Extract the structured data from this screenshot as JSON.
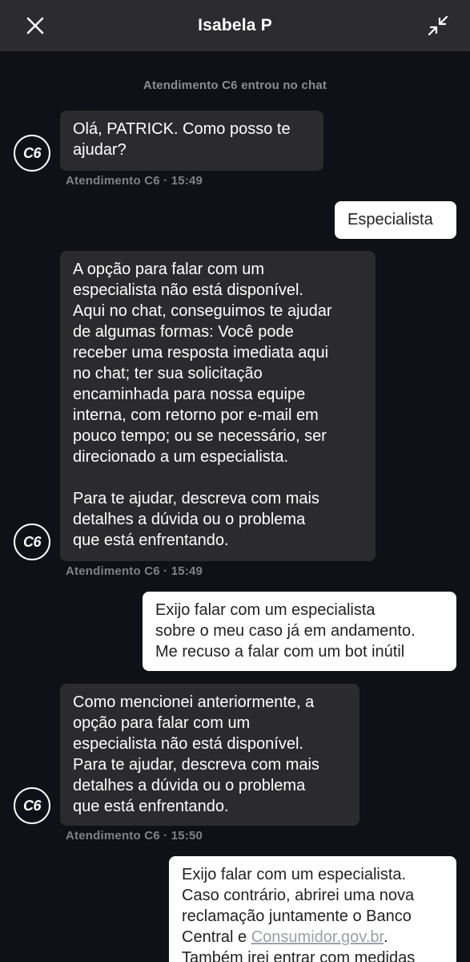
{
  "header": {
    "title": "Isabela P",
    "close_icon": "close-icon",
    "minimize_icon": "minimize-icon"
  },
  "chat": {
    "system_message": "Atendimento C6 entrou no chat",
    "avatar_label": "C6",
    "messages": [
      {
        "sender": "agent",
        "text": "Olá, PATRICK. Como posso te\najudar?",
        "meta": "Atendimento C6 · 15:49"
      },
      {
        "sender": "user",
        "text": "Especialista"
      },
      {
        "sender": "agent",
        "text": "A opção para falar com um\nespecialista não está disponível.\nAqui no chat, conseguimos te ajudar\nde algumas formas: Você pode\nreceber uma resposta imediata aqui\nno chat; ter sua solicitação\nencaminhada para nossa equipe\ninterna, com retorno por e-mail em\npouco tempo; ou se necessário, ser\ndirecionado a um especialista.\n\nPara te ajudar, descreva com mais\ndetalhes a dúvida ou o problema\nque está enfrentando.",
        "meta": "Atendimento C6 · 15:49"
      },
      {
        "sender": "user",
        "text": "Exijo falar com um especialista\nsobre o meu caso já em andamento.\nMe recuso a falar com um bot inútil"
      },
      {
        "sender": "agent",
        "text": "Como mencionei anteriormente, a\nopção para falar com um\nespecialista não está disponível.\nPara te ajudar, descreva com mais\ndetalhes a dúvida ou o problema\nque está enfrentando.",
        "meta": "Atendimento C6 · 15:50"
      },
      {
        "sender": "user",
        "text_before_link": "Exijo falar com um especialista.\nCaso contrário, abrirei uma nova\nreclamação juntamente o Banco\nCentral e ",
        "link": "Consumidor.gov.br",
        "text_after_link": ".\nTambém irei entrar com medidas"
      }
    ]
  },
  "colors": {
    "background": "#0e1116",
    "header": "#2c2c2e",
    "agent_bubble": "#2b2b2d",
    "user_bubble": "#ffffff",
    "meta_text": "#7f8288"
  }
}
